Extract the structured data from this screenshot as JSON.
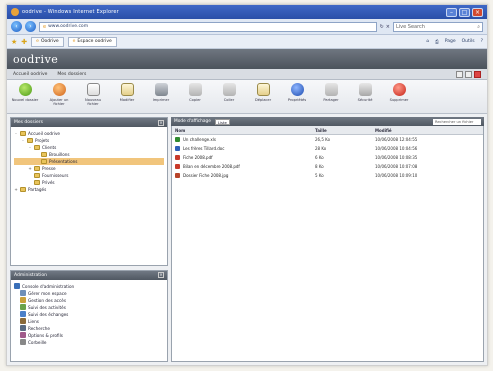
{
  "browser": {
    "title": "oodrive - Windows Internet Explorer",
    "url": "www.oodrive.com",
    "search_placeholder": "Live Search",
    "tabs": [
      {
        "label": "Oodrive",
        "active": false
      },
      {
        "label": "Espace oodrive",
        "active": true
      }
    ],
    "commands": [
      "Page",
      "Outils"
    ]
  },
  "app": {
    "brand": "oodrive",
    "subbar_left": "Accueil oodrive",
    "subbar_right": "Mes dossiers"
  },
  "toolbar": {
    "items": [
      {
        "label": "Nouvel dossier",
        "icon": "add-icon",
        "style": "ic-green"
      },
      {
        "label": "Ajouter un fichier",
        "icon": "upload-icon",
        "style": "ic-orange"
      },
      {
        "label": "Nouveau fichier",
        "icon": "document-icon",
        "style": "ic-doc"
      },
      {
        "label": "Modifier",
        "icon": "edit-icon",
        "style": "ic-doc2"
      },
      {
        "label": "Imprimer",
        "icon": "printer-icon",
        "style": "ic-printer"
      },
      {
        "label": "Copier",
        "icon": "copy-icon",
        "style": "ic-gray"
      },
      {
        "label": "Coller",
        "icon": "paste-icon",
        "style": "ic-gray"
      },
      {
        "label": "Déplacer",
        "icon": "move-icon",
        "style": "ic-doc2"
      },
      {
        "label": "Propriétés",
        "icon": "info-icon",
        "style": "ic-blue"
      },
      {
        "label": "Partager",
        "icon": "share-icon",
        "style": "ic-gray"
      },
      {
        "label": "Sécurité",
        "icon": "lock-icon",
        "style": "ic-lock"
      },
      {
        "label": "Supprimer",
        "icon": "delete-icon",
        "style": "ic-red"
      }
    ]
  },
  "folders_panel": {
    "title": "Mes dossiers",
    "tree": [
      {
        "label": "Accueil oodrive",
        "level": 0,
        "toggle": "-"
      },
      {
        "label": "Projets",
        "level": 1,
        "toggle": "-"
      },
      {
        "label": "Clients",
        "level": 2,
        "toggle": "-"
      },
      {
        "label": "Brouillons",
        "level": 3,
        "toggle": ""
      },
      {
        "label": "Présentations",
        "level": 3,
        "toggle": "",
        "selected": true
      },
      {
        "label": "Presse",
        "level": 2,
        "toggle": "+"
      },
      {
        "label": "Fournisseurs",
        "level": 2,
        "toggle": ""
      },
      {
        "label": "Privés",
        "level": 2,
        "toggle": ""
      },
      {
        "label": "Partagés",
        "level": 0,
        "toggle": "+"
      }
    ]
  },
  "admin_panel": {
    "title": "Administration",
    "items": [
      {
        "label": "Console d'administration",
        "color": "#3a6fb8"
      },
      {
        "label": "Gérer mon espace",
        "color": "#6e8fb8"
      },
      {
        "label": "Gestion des accès",
        "color": "#c9a13a"
      },
      {
        "label": "Suivi des activités",
        "color": "#6aa34a"
      },
      {
        "label": "Suivi des échanges",
        "color": "#4a7fc9"
      },
      {
        "label": "Liens",
        "color": "#8a6a3a"
      },
      {
        "label": "Recherche",
        "color": "#5a6b82"
      },
      {
        "label": "Options & profils",
        "color": "#a05a8a"
      },
      {
        "label": "Corbeille",
        "color": "#888888"
      }
    ]
  },
  "files_panel": {
    "view_label": "Mode d'affichage",
    "view_value": "Liste",
    "search_placeholder": "Rechercher un fichier",
    "columns": [
      "Nom",
      "Taille",
      "Modifié"
    ],
    "rows": [
      {
        "name": "Un challenge.xls",
        "size": "26,5 Ko",
        "modified": "10/06/2008 12:04:55",
        "color": "#2f8a2f"
      },
      {
        "name": "Les frères Tillard.doc",
        "size": "28 Ko",
        "modified": "10/06/2008 10:04:56",
        "color": "#2d5fb8"
      },
      {
        "name": "Fiche 2008.pdf",
        "size": "6 Ko",
        "modified": "10/06/2008 10:08:35",
        "color": "#c83a2a"
      },
      {
        "name": "Bilan en décembre 2008.pdf",
        "size": "8 Ko",
        "modified": "10/06/2008 10:07:08",
        "color": "#c83a2a"
      },
      {
        "name": "Dossier Fiche 2008.jpg",
        "size": "5 Ko",
        "modified": "10/06/2008 10:09:10",
        "color": "#b8442a"
      }
    ]
  }
}
